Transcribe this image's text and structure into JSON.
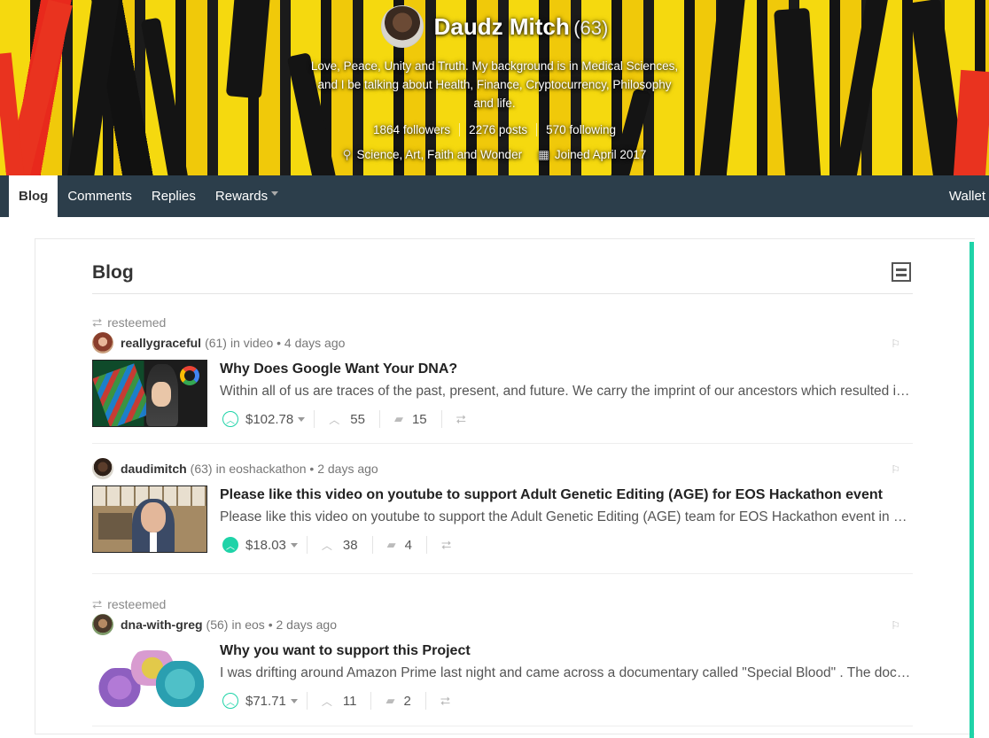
{
  "profile": {
    "name": "Daudz Mitch",
    "reputation": "(63)",
    "about": "Love, Peace, Unity and Truth. My background is in Medical Sciences, and I be talking about Health, Finance, Cryptocurrency, Philosophy and life.",
    "followers": "1864 followers",
    "posts": "2276 posts",
    "following": "570 following",
    "location": "Science, Art, Faith and Wonder",
    "joined": "Joined April 2017"
  },
  "nav": {
    "tabs": [
      "Blog",
      "Comments",
      "Replies",
      "Rewards"
    ],
    "wallet": "Wallet"
  },
  "blog": {
    "title": "Blog"
  },
  "posts": [
    {
      "resteemed_label": "resteemed",
      "author": "reallygraceful",
      "rep": "(61)",
      "meta": "in video • 4 days ago",
      "title": "Why Does Google Want Your DNA?",
      "excerpt": "Within all of us are traces of the past, present, and future. We carry the imprint of our ancestors which resulted in us being who we are today.",
      "payout": "$102.78",
      "votes": "55",
      "comments": "15"
    },
    {
      "author": "daudimitch",
      "rep": "(63)",
      "meta": "in eoshackathon • 2 days ago",
      "title": "Please like this video on youtube to support Adult Genetic Editing (AGE) for EOS Hackathon event",
      "excerpt": "Please like this video on youtube to support the Adult Genetic Editing (AGE) team for EOS Hackathon event in Hong Kong.",
      "payout": "$18.03",
      "votes": "38",
      "comments": "4"
    },
    {
      "resteemed_label": "resteemed",
      "author": "dna-with-greg",
      "rep": "(56)",
      "meta": "in eos • 2 days ago",
      "title": "Why you want to support this Project",
      "excerpt": "I was drifting around Amazon Prime last night and came across a documentary called \"Special Blood\" . The documentary was about",
      "payout": "$71.71",
      "votes": "11",
      "comments": "2"
    }
  ],
  "colors": {
    "nav_bg": "#2c3e4b",
    "accent": "#1fd3a8"
  }
}
